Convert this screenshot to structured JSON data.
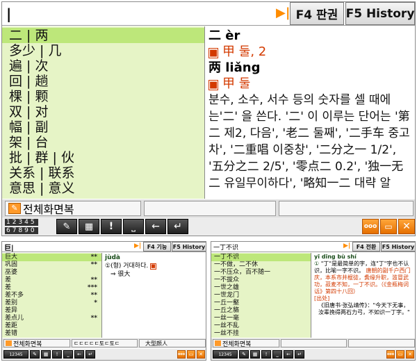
{
  "main": {
    "input": "|",
    "tab_f4": "F4 판권",
    "tab_f5": "F5 History",
    "list": [
      "二 | 两",
      "多少 | 几",
      "遍 | 次",
      "回 | 趟",
      "棵 | 颗",
      "双 | 对",
      "幅 | 副",
      "架 | 台",
      "批 | 群 | 伙",
      "关系 | 联系",
      "意思 | 意义"
    ],
    "def": {
      "h1": "二 èr",
      "t1": "甲 둘, 2",
      "h2": "两 liǎng",
      "t2": "甲 둘",
      "body": "분수, 소수, 서수 등의 숫자를 셀 때에는'二' 을 쓴다. '二' 이 이루는 단어는 '第二 제2, 다음', '老二 둘째', '二手车 중고차', '二重唱 이중창', '二分之一 1/2', '五分之二 2/5', '零点二 0.2', '独一无二 유일무이하다', '略知一二 대략 알"
    },
    "status1": "전체화면복",
    "status2": "",
    "status3": "",
    "numpad": [
      "12345",
      "67890"
    ],
    "icons": [
      "pencil-eraser-icon",
      "keyboard-icon",
      "exclamation-icon",
      "space-icon",
      "backspace-icon",
      "enter-icon",
      "hanja-icon",
      "minimize-icon",
      "close-icon"
    ]
  },
  "left": {
    "input": "巨|",
    "tab_f4": "F4 기능",
    "tab_f5": "F5 History",
    "list": [
      {
        "w": "巨大",
        "s": "**"
      },
      {
        "w": "巩固",
        "s": "**"
      },
      {
        "w": "巫婆",
        "s": ""
      },
      {
        "w": "差",
        "s": "**"
      },
      {
        "w": "差",
        "s": "***"
      },
      {
        "w": "差不多",
        "s": "**"
      },
      {
        "w": "差别",
        "s": "*"
      },
      {
        "w": "差异",
        "s": ""
      },
      {
        "w": "差点儿",
        "s": "**"
      },
      {
        "w": "差距",
        "s": ""
      },
      {
        "w": "差错",
        "s": ""
      }
    ],
    "def": {
      "head": "jùdà",
      "sense": "①(형) 거대하다.",
      "ref": "⇒ 很大"
    },
    "status1": "전체화면복",
    "status2": "ㄷㄷㄷㄷㄷ토ㄷ토ㄷ",
    "status3": "大型颜人"
  },
  "right": {
    "input": "一丁不识",
    "tab_f4": "F4 전환",
    "tab_f5": "F5 History",
    "list": [
      "一丁不识",
      "一不做，二不休",
      "一不压众，百不随一",
      "一不拔众",
      "一世之雄",
      "一世龙门",
      "一丘一壑",
      "一丘之貉",
      "一丝一毫",
      "一丝不乱",
      "一丝不挂"
    ],
    "def": {
      "head": "yī dīng bù shí",
      "line1": "\"丁\"是最简单的字，连\"丁\"字也不认识，比喻一字不识。",
      "line1b": "唐朝的副千户西门庆，本系市井棍徒，夤缘升职，滥冒武功，菽麦不知，一丁不识。（《金瓶梅词话》第四十八回）",
      "source": "[出处]",
      "line2": "《旧唐书·张弘靖传》：\"今天下无事，汝辈挽得两石力弓，不如识一丁字。\""
    },
    "status1": "전체화면복",
    "status2": "",
    "status3": ""
  }
}
